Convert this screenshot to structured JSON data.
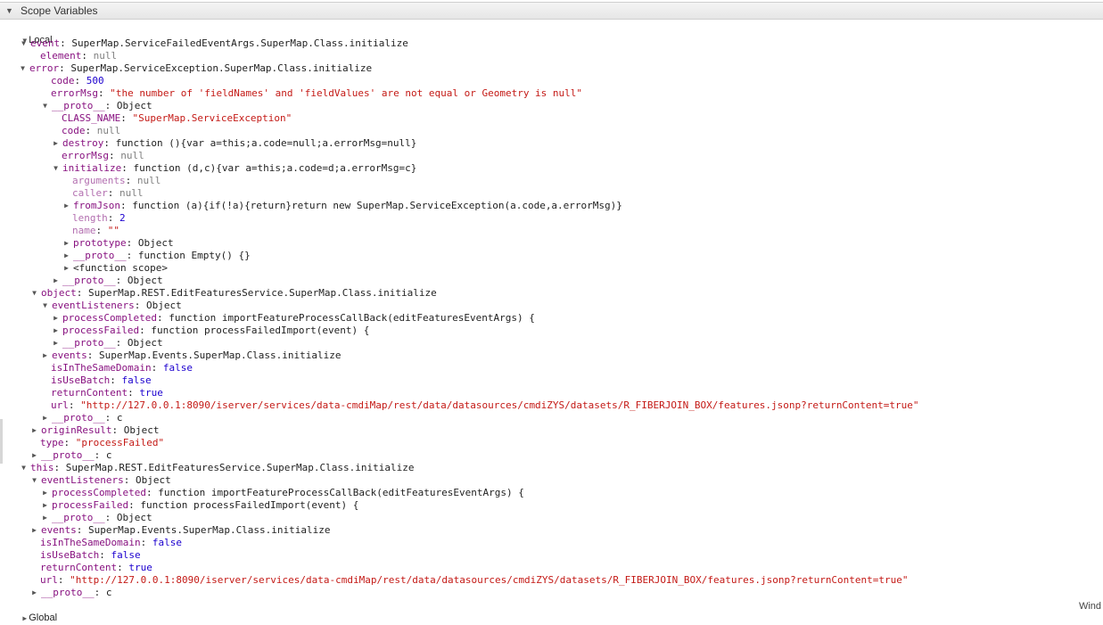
{
  "panel": {
    "title": "Scope Variables"
  },
  "sections": {
    "local": "Local",
    "global": "Global"
  },
  "corner_label": "Wind",
  "tree": [
    {
      "arrow": "down",
      "key": "event",
      "sep": ": ",
      "value": "SuperMap.ServiceFailedEventArgs.SuperMap.Class.initialize",
      "vtype": "plain"
    },
    {
      "arrow": "none",
      "key": "element",
      "sep": ": ",
      "value": "null",
      "vtype": "kw"
    },
    {
      "arrow": "down",
      "key": "error",
      "sep": ": ",
      "value": "SuperMap.ServiceException.SuperMap.Class.initialize",
      "vtype": "plain"
    },
    {
      "arrow": "none",
      "key": "code",
      "sep": ": ",
      "value": "500",
      "vtype": "num"
    },
    {
      "arrow": "none",
      "key": "errorMsg",
      "sep": ": ",
      "value": "\"the number of 'fieldNames' and 'fieldValues' are not equal or Geometry is null\"",
      "vtype": "str"
    },
    {
      "arrow": "down",
      "key": "__proto__",
      "sep": ": ",
      "value": "Object",
      "vtype": "plain"
    },
    {
      "arrow": "none",
      "key": "CLASS_NAME",
      "sep": ": ",
      "value": "\"SuperMap.ServiceException\"",
      "vtype": "str"
    },
    {
      "arrow": "none",
      "key": "code",
      "sep": ": ",
      "value": "null",
      "vtype": "kw"
    },
    {
      "arrow": "right",
      "key": "destroy",
      "sep": ": ",
      "value": "function (){var a=this;a.code=null;a.errorMsg=null}",
      "vtype": "plain"
    },
    {
      "arrow": "none",
      "key": "errorMsg",
      "sep": ": ",
      "value": "null",
      "vtype": "kw"
    },
    {
      "arrow": "down",
      "key": "initialize",
      "sep": ": ",
      "value": "function (d,c){var a=this;a.code=d;a.errorMsg=c}",
      "vtype": "plain"
    },
    {
      "arrow": "none",
      "key": "arguments",
      "sep": ": ",
      "value": "null",
      "vtype": "kw",
      "dim": true
    },
    {
      "arrow": "none",
      "key": "caller",
      "sep": ": ",
      "value": "null",
      "vtype": "kw",
      "dim": true
    },
    {
      "arrow": "right",
      "key": "fromJson",
      "sep": ": ",
      "value": "function (a){if(!a){return}return new SuperMap.ServiceException(a.code,a.errorMsg)}",
      "vtype": "plain"
    },
    {
      "arrow": "none",
      "key": "length",
      "sep": ": ",
      "value": "2",
      "vtype": "num",
      "dim": true
    },
    {
      "arrow": "none",
      "key": "name",
      "sep": ": ",
      "value": "\"\"",
      "vtype": "str",
      "dim": true
    },
    {
      "arrow": "right",
      "key": "prototype",
      "sep": ": ",
      "value": "Object",
      "vtype": "plain"
    },
    {
      "arrow": "right",
      "key": "__proto__",
      "sep": ": ",
      "value": "function Empty() {}",
      "vtype": "plain"
    },
    {
      "arrow": "right",
      "key": "<function scope>",
      "sep": "",
      "value": "",
      "vtype": "plain",
      "plainkey": true
    },
    {
      "arrow": "right",
      "key": "__proto__",
      "sep": ": ",
      "value": "Object",
      "vtype": "plain"
    },
    {
      "arrow": "down",
      "key": "object",
      "sep": ": ",
      "value": "SuperMap.REST.EditFeaturesService.SuperMap.Class.initialize",
      "vtype": "plain"
    },
    {
      "arrow": "down",
      "key": "eventListeners",
      "sep": ": ",
      "value": "Object",
      "vtype": "plain"
    },
    {
      "arrow": "right",
      "key": "processCompleted",
      "sep": ": ",
      "value": "function importFeatureProcessCallBack(editFeaturesEventArgs) {",
      "vtype": "plain"
    },
    {
      "arrow": "right",
      "key": "processFailed",
      "sep": ": ",
      "value": "function processFailedImport(event) {",
      "vtype": "plain"
    },
    {
      "arrow": "right",
      "key": "__proto__",
      "sep": ": ",
      "value": "Object",
      "vtype": "plain"
    },
    {
      "arrow": "right",
      "key": "events",
      "sep": ": ",
      "value": "SuperMap.Events.SuperMap.Class.initialize",
      "vtype": "plain"
    },
    {
      "arrow": "none",
      "key": "isInTheSameDomain",
      "sep": ": ",
      "value": "false",
      "vtype": "num"
    },
    {
      "arrow": "none",
      "key": "isUseBatch",
      "sep": ": ",
      "value": "false",
      "vtype": "num"
    },
    {
      "arrow": "none",
      "key": "returnContent",
      "sep": ": ",
      "value": "true",
      "vtype": "num"
    },
    {
      "arrow": "none",
      "key": "url",
      "sep": ": ",
      "value": "\"http://127.0.0.1:8090/iserver/services/data-cmdiMap/rest/data/datasources/cmdiZYS/datasets/R_FIBERJOIN_BOX/features.jsonp?returnContent=true\"",
      "vtype": "str"
    },
    {
      "arrow": "right",
      "key": "__proto__",
      "sep": ": ",
      "value": "c",
      "vtype": "plain"
    },
    {
      "arrow": "right",
      "key": "originResult",
      "sep": ": ",
      "value": "Object",
      "vtype": "plain"
    },
    {
      "arrow": "none",
      "key": "type",
      "sep": ": ",
      "value": "\"processFailed\"",
      "vtype": "str"
    },
    {
      "arrow": "right",
      "key": "__proto__",
      "sep": ": ",
      "value": "c",
      "vtype": "plain"
    },
    {
      "arrow": "down",
      "key": "this",
      "sep": ": ",
      "value": "SuperMap.REST.EditFeaturesService.SuperMap.Class.initialize",
      "vtype": "plain"
    },
    {
      "arrow": "down",
      "key": "eventListeners",
      "sep": ": ",
      "value": "Object",
      "vtype": "plain"
    },
    {
      "arrow": "right",
      "key": "processCompleted",
      "sep": ": ",
      "value": "function importFeatureProcessCallBack(editFeaturesEventArgs) {",
      "vtype": "plain"
    },
    {
      "arrow": "right",
      "key": "processFailed",
      "sep": ": ",
      "value": "function processFailedImport(event) {",
      "vtype": "plain"
    },
    {
      "arrow": "right",
      "key": "__proto__",
      "sep": ": ",
      "value": "Object",
      "vtype": "plain"
    },
    {
      "arrow": "right",
      "key": "events",
      "sep": ": ",
      "value": "SuperMap.Events.SuperMap.Class.initialize",
      "vtype": "plain"
    },
    {
      "arrow": "none",
      "key": "isInTheSameDomain",
      "sep": ": ",
      "value": "false",
      "vtype": "num"
    },
    {
      "arrow": "none",
      "key": "isUseBatch",
      "sep": ": ",
      "value": "false",
      "vtype": "num"
    },
    {
      "arrow": "none",
      "key": "returnContent",
      "sep": ": ",
      "value": "true",
      "vtype": "num"
    },
    {
      "arrow": "none",
      "key": "url",
      "sep": ": ",
      "value": "\"http://127.0.0.1:8090/iserver/services/data-cmdiMap/rest/data/datasources/cmdiZYS/datasets/R_FIBERJOIN_BOX/features.jsonp?returnContent=true\"",
      "vtype": "str"
    },
    {
      "arrow": "right",
      "key": "__proto__",
      "sep": ": ",
      "value": "c",
      "vtype": "plain"
    }
  ]
}
